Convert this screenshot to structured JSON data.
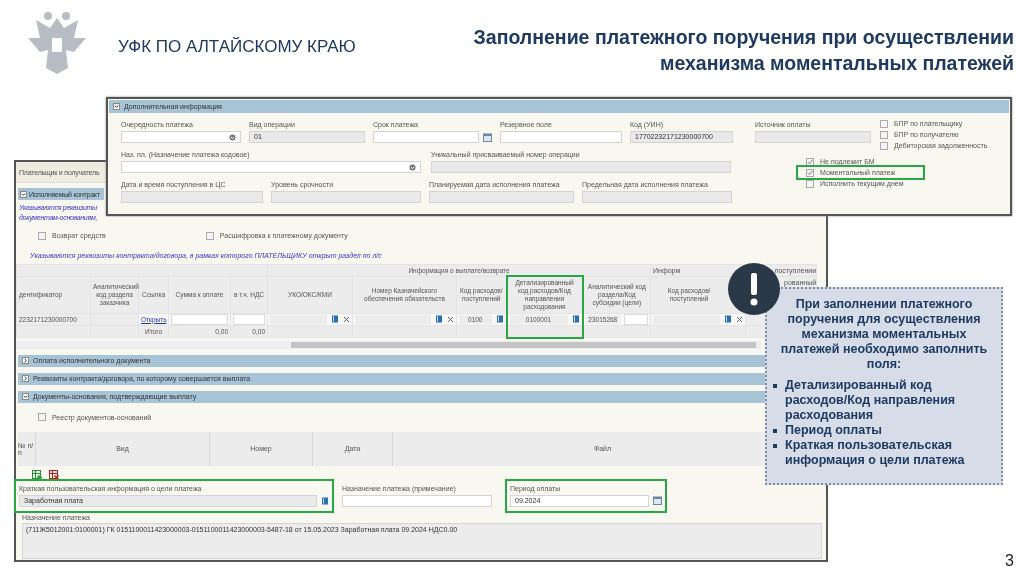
{
  "slide": {
    "org_name": "УФК ПО АЛТАЙСКОМУ КРАЮ",
    "title_lines": [
      "Заполнение платежного поручения при осуществлении",
      "механизма моментальных платежей"
    ],
    "page_number": "3"
  },
  "back_window": {
    "tab": "Плательщик и получатель",
    "contract_section": {
      "title": "Исполняемый контракт",
      "expanded": true,
      "hint_lines": [
        "Указываются реквизиты",
        "документам-основаниям,"
      ]
    },
    "checkboxes": [
      {
        "label": "Возврат средств",
        "checked": false
      },
      {
        "label": "Расшифровка к платежному документу",
        "checked": false
      }
    ],
    "table_hint": "Указываются реквизиты контракта/договора, в рамках которого ПЛАТЕЛЬЩИКУ открыт раздел по л/с",
    "contract_table": {
      "groups": [
        {
          "label": "Информация о выплате/возврате"
        },
        {
          "label": "Информ"
        },
        {
          "label": "поступлении"
        }
      ],
      "columns": [
        {
          "header": "дентификатор",
          "highlighted": false
        },
        {
          "header": "Аналитический код раздела заказчика",
          "highlighted": false
        },
        {
          "header": "Ссылка",
          "highlighted": false
        },
        {
          "header": "Сумма к оплате",
          "highlighted": false
        },
        {
          "header": "в т.ч. НДС",
          "highlighted": false
        },
        {
          "header": "УКО/ОКС/КМИ",
          "highlighted": false
        },
        {
          "header": "Номер Казначейского обеспечения обязательств",
          "highlighted": false
        },
        {
          "header": "Код расходов/ поступлений",
          "highlighted": false
        },
        {
          "header": "Детализированный код расходов/Код направления расходования",
          "highlighted": true
        },
        {
          "header": "Аналитический код раздела/Код субсидии (цели)",
          "highlighted": false
        },
        {
          "header": "Код расходов/ поступлений",
          "highlighted": false
        },
        {
          "header": "рованный",
          "highlighted": false
        }
      ],
      "row": [
        {
          "kind": "text",
          "value": "2232171230000700"
        },
        {
          "kind": "text"
        },
        {
          "kind": "link",
          "value": "Открыть"
        },
        {
          "kind": "input"
        },
        {
          "kind": "input"
        },
        {
          "kind": "lookup",
          "clear": true
        },
        {
          "kind": "lookup",
          "clear": true
        },
        {
          "kind": "lookup",
          "value": "0100",
          "clear": false
        },
        {
          "kind": "lookup",
          "value": "0100001",
          "clear": false
        },
        {
          "kind": "pair",
          "value": "23015268"
        },
        {
          "kind": "lookup",
          "clear": true
        },
        {
          "kind": "text"
        }
      ],
      "total_label": "Итого",
      "totals": [
        "0,00",
        "0,00"
      ]
    },
    "sections": [
      {
        "title": "Оплата исполнительного документа",
        "expanded": false
      },
      {
        "title": "Реквизиты контракта/договора, по которому совершается выплата",
        "expanded": false
      },
      {
        "title": "Документы-основания, подтверждающие выплату",
        "expanded": true
      }
    ],
    "register_checkbox": {
      "label": "Реестр документов-оснований",
      "checked": false
    },
    "docs_table": {
      "columns": [
        "№ п/п",
        "Вид",
        "Номер",
        "Дата",
        "Файл"
      ]
    },
    "fields": [
      {
        "kind": "lookup",
        "label": "Краткая пользовательская информация о цели платежа",
        "value": "Заработная плата",
        "highlighted": true
      },
      {
        "kind": "input",
        "label": "Назначение платежа (примечание)",
        "highlighted": false
      },
      {
        "kind": "date",
        "label": "Период оплаты",
        "value": "09.2024",
        "highlighted": true
      }
    ],
    "purpose": {
      "label": "Назначение платежа",
      "value": "(711Ж5012001:0100001) ГК 0151100011423000003-0151100011423000003-5487-18 от 15.05.2023 Заработная плата 09.2024 НДС0.00"
    }
  },
  "front_window": {
    "title": "Дополнительная информация",
    "expanded": true,
    "rows": [
      {
        "fields": [
          {
            "kind": "dropdown",
            "label": "Очередность платежа"
          },
          {
            "kind": "readonly",
            "label": "Вид операции",
            "value": "01"
          },
          {
            "kind": "date",
            "label": "Срок платежа"
          },
          {
            "kind": "input",
            "label": "Резервное поле"
          },
          {
            "kind": "readonly",
            "label": "Код (УИН)",
            "value": "17702232171230000700"
          },
          {
            "kind": "readonly",
            "label": "Источник оплаты"
          }
        ]
      },
      {
        "fields": [
          {
            "kind": "dropdown",
            "label": "Наз. пл. (Назначение платежа кодовое)"
          },
          {
            "kind": "readonly",
            "label": "Уникальный присваиваемый номер операции"
          }
        ]
      },
      {
        "fields": [
          {
            "kind": "readonly",
            "label": "Дата и время поступления в ЦС"
          },
          {
            "kind": "readonly",
            "label": "Уровень срочности"
          },
          {
            "kind": "readonly",
            "label": "Планируемая дата исполнения платежа"
          },
          {
            "kind": "readonly",
            "label": "Предельная дата исполнения платежа"
          }
        ]
      }
    ],
    "checks_top": [
      {
        "label": "БПР по плательщику",
        "checked": false,
        "highlighted": false
      },
      {
        "label": "БПР по получателю",
        "checked": false,
        "highlighted": false
      },
      {
        "label": "Дебиторская задолженность",
        "checked": false,
        "highlighted": false
      }
    ],
    "checks_bottom": [
      {
        "label": "Не подлежит БМ",
        "checked": true,
        "highlighted": false
      },
      {
        "label": "Моментальный платеж",
        "checked": true,
        "highlighted": true
      },
      {
        "label": "Исполнить текущим днем",
        "checked": false,
        "highlighted": false
      }
    ]
  },
  "callout": {
    "intro": "При заполнении платежного поручения для осуществления механизма моментальных платежей необходимо заполнить поля:",
    "items": [
      "Детализированный код расходов/Код направления расходования",
      "Период оплаты",
      "Краткая пользовательская информация о цели платежа"
    ]
  }
}
